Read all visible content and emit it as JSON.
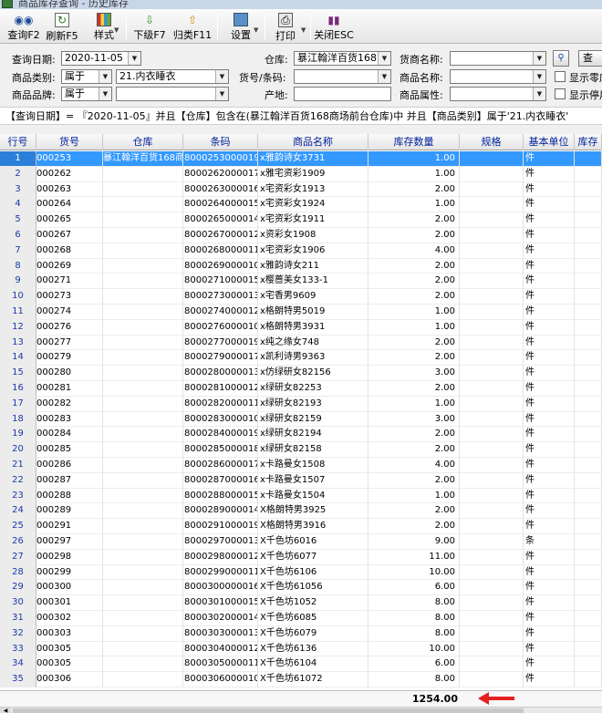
{
  "window": {
    "title": "商品库存查询 - 历史库存"
  },
  "toolbar": {
    "query": "查询F2",
    "refresh": "刷新F5",
    "style": "样式",
    "drill_down": "下级F7",
    "roll_up": "归类F11",
    "settings": "设置",
    "print": "打印",
    "close": "关闭ESC"
  },
  "filters": {
    "query_date_label": "查询日期:",
    "query_date": "2020-11-05",
    "warehouse_label": "仓库:",
    "warehouse": "暴江翰洋百货168",
    "supplier_label": "货商名称:",
    "supplier": "",
    "search_label": "查 询",
    "category_label": "商品类别:",
    "category_op": "属于",
    "category_value": "21.内衣睡衣",
    "code_label": "货号/条码:",
    "code": "",
    "name_label": "商品名称:",
    "name": "",
    "show_zero_label": "显示零库",
    "brand_label": "商品品牌:",
    "brand_op": "属于",
    "brand_value": "",
    "origin_label": "产地:",
    "origin": "",
    "attr_label": "商品属性:",
    "attr": "",
    "show_stopped_label": "显示停用"
  },
  "condition": "【查询日期】= 『2020-11-05』并且【仓库】包含在(暴江翰洋百货168商场前台仓库)中 并且【商品类别】属于'21.内衣睡衣'",
  "grid": {
    "headers": {
      "no": "行号",
      "item": "货号",
      "warehouse": "仓库",
      "barcode": "条码",
      "name": "商品名称",
      "qty": "库存数量",
      "spec": "规格",
      "unit": "基本单位",
      "extra": "库存"
    },
    "rows": [
      {
        "no": "1",
        "item": "000253",
        "warehouse": "暴江翰洋百货168商",
        "barcode": "8000253000019",
        "name": "x雅韵诗女3731",
        "qty": "1.00",
        "unit": "件"
      },
      {
        "no": "2",
        "item": "000262",
        "warehouse": "",
        "barcode": "8000262000017",
        "name": "x雅宅资彩1909",
        "qty": "1.00",
        "unit": "件"
      },
      {
        "no": "3",
        "item": "000263",
        "warehouse": "",
        "barcode": "8000263000016",
        "name": "x宅资彩女1913",
        "qty": "2.00",
        "unit": "件"
      },
      {
        "no": "4",
        "item": "000264",
        "warehouse": "",
        "barcode": "8000264000015",
        "name": "x宅资彩女1924",
        "qty": "1.00",
        "unit": "件"
      },
      {
        "no": "5",
        "item": "000265",
        "warehouse": "",
        "barcode": "8000265000014",
        "name": "x宅资彩女1911",
        "qty": "2.00",
        "unit": "件"
      },
      {
        "no": "6",
        "item": "000267",
        "warehouse": "",
        "barcode": "8000267000012",
        "name": "x资彩女1908",
        "qty": "2.00",
        "unit": "件"
      },
      {
        "no": "7",
        "item": "000268",
        "warehouse": "",
        "barcode": "8000268000011",
        "name": "x宅资彩女1906",
        "qty": "4.00",
        "unit": "件"
      },
      {
        "no": "8",
        "item": "000269",
        "warehouse": "",
        "barcode": "8000269000010",
        "name": "x雅韵诗女211",
        "qty": "2.00",
        "unit": "件"
      },
      {
        "no": "9",
        "item": "000271",
        "warehouse": "",
        "barcode": "8000271000015",
        "name": "x樱蔷美女133-1",
        "qty": "2.00",
        "unit": "件"
      },
      {
        "no": "10",
        "item": "000273",
        "warehouse": "",
        "barcode": "8000273000013",
        "name": "x宅香男9609",
        "qty": "2.00",
        "unit": "件"
      },
      {
        "no": "11",
        "item": "000274",
        "warehouse": "",
        "barcode": "8000274000012",
        "name": "x格朗特男5019",
        "qty": "1.00",
        "unit": "件"
      },
      {
        "no": "12",
        "item": "000276",
        "warehouse": "",
        "barcode": "8000276000010",
        "name": "x格朗特男3931",
        "qty": "1.00",
        "unit": "件"
      },
      {
        "no": "13",
        "item": "000277",
        "warehouse": "",
        "barcode": "8000277000019",
        "name": "x纯之缘女748",
        "qty": "2.00",
        "unit": "件"
      },
      {
        "no": "14",
        "item": "000279",
        "warehouse": "",
        "barcode": "8000279000017",
        "name": "x凯利诗男9363",
        "qty": "2.00",
        "unit": "件"
      },
      {
        "no": "15",
        "item": "000280",
        "warehouse": "",
        "barcode": "8000280000013",
        "name": "x仿绿研女82156",
        "qty": "3.00",
        "unit": "件"
      },
      {
        "no": "16",
        "item": "000281",
        "warehouse": "",
        "barcode": "8000281000012",
        "name": "x绿研女82253",
        "qty": "2.00",
        "unit": "件"
      },
      {
        "no": "17",
        "item": "000282",
        "warehouse": "",
        "barcode": "8000282000011",
        "name": "x绿研女82193",
        "qty": "1.00",
        "unit": "件"
      },
      {
        "no": "18",
        "item": "000283",
        "warehouse": "",
        "barcode": "8000283000010",
        "name": "x绿研女82159",
        "qty": "3.00",
        "unit": "件"
      },
      {
        "no": "19",
        "item": "000284",
        "warehouse": "",
        "barcode": "8000284000019",
        "name": "x绿研女82194",
        "qty": "2.00",
        "unit": "件"
      },
      {
        "no": "20",
        "item": "000285",
        "warehouse": "",
        "barcode": "8000285000018",
        "name": "x绿研女82158",
        "qty": "2.00",
        "unit": "件"
      },
      {
        "no": "21",
        "item": "000286",
        "warehouse": "",
        "barcode": "8000286000017",
        "name": "x卡路曼女1508",
        "qty": "4.00",
        "unit": "件"
      },
      {
        "no": "22",
        "item": "000287",
        "warehouse": "",
        "barcode": "8000287000016",
        "name": "x卡路曼女1507",
        "qty": "2.00",
        "unit": "件"
      },
      {
        "no": "23",
        "item": "000288",
        "warehouse": "",
        "barcode": "8000288000015",
        "name": "x卡路曼女1504",
        "qty": "1.00",
        "unit": "件"
      },
      {
        "no": "24",
        "item": "000289",
        "warehouse": "",
        "barcode": "8000289000014",
        "name": "X格朗特男3925",
        "qty": "2.00",
        "unit": "件"
      },
      {
        "no": "25",
        "item": "000291",
        "warehouse": "",
        "barcode": "8000291000019",
        "name": "X格朗特男3916",
        "qty": "2.00",
        "unit": "件"
      },
      {
        "no": "26",
        "item": "000297",
        "warehouse": "",
        "barcode": "8000297000013",
        "name": "X千色坊6016",
        "qty": "9.00",
        "unit": "条"
      },
      {
        "no": "27",
        "item": "000298",
        "warehouse": "",
        "barcode": "8000298000012",
        "name": "X千色坊6077",
        "qty": "11.00",
        "unit": "件"
      },
      {
        "no": "28",
        "item": "000299",
        "warehouse": "",
        "barcode": "8000299000011",
        "name": "X千色坊6106",
        "qty": "10.00",
        "unit": "件"
      },
      {
        "no": "29",
        "item": "000300",
        "warehouse": "",
        "barcode": "8000300000016",
        "name": "X千色坊61056",
        "qty": "6.00",
        "unit": "件"
      },
      {
        "no": "30",
        "item": "000301",
        "warehouse": "",
        "barcode": "8000301000015",
        "name": "X千色坊1052",
        "qty": "8.00",
        "unit": "件"
      },
      {
        "no": "31",
        "item": "000302",
        "warehouse": "",
        "barcode": "8000302000014",
        "name": "X千色坊6085",
        "qty": "8.00",
        "unit": "件"
      },
      {
        "no": "32",
        "item": "000303",
        "warehouse": "",
        "barcode": "8000303000013",
        "name": "X千色坊6079",
        "qty": "8.00",
        "unit": "件"
      },
      {
        "no": "33",
        "item": "000305",
        "warehouse": "",
        "barcode": "8000304000012",
        "name": "X千色坊6136",
        "qty": "10.00",
        "unit": "件"
      },
      {
        "no": "34",
        "item": "000305",
        "warehouse": "",
        "barcode": "8000305000011",
        "name": "X千色坊6104",
        "qty": "6.00",
        "unit": "件"
      },
      {
        "no": "35",
        "item": "000306",
        "warehouse": "",
        "barcode": "8000306000010",
        "name": "X千色坊61072",
        "qty": "8.00",
        "unit": "件"
      }
    ],
    "total_qty": "1254.00"
  },
  "colors": {
    "selected_row": "#3399ff",
    "header_text": "#00209a",
    "annotation_arrow": "#e82020"
  }
}
